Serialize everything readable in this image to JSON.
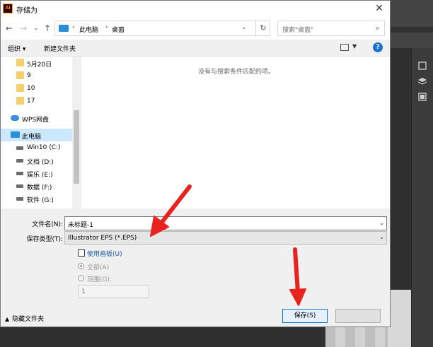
{
  "window": {
    "app_icon_text": "Ai",
    "title": "存储为"
  },
  "navigation": {
    "back_glyph": "←",
    "forward_glyph": "→",
    "history_glyph": "⌄",
    "up_glyph": "↑",
    "breadcrumb": [
      "此电脑",
      "桌面"
    ],
    "search_placeholder": "搜索\"桌面\""
  },
  "toolbar": {
    "organize_label": "组织 ▾",
    "new_folder_label": "新建文件夹",
    "help_glyph": "?"
  },
  "sidebar": {
    "items": [
      {
        "label": "5月20日",
        "icon": "folder-icon"
      },
      {
        "label": "9",
        "icon": "folder-icon"
      },
      {
        "label": "10",
        "icon": "folder-icon"
      },
      {
        "label": "17",
        "icon": "folder-icon"
      },
      {
        "label": "WPS网盘",
        "icon": "cloud-icon"
      },
      {
        "label": "此电脑",
        "icon": "computer-icon",
        "selected": true
      },
      {
        "label": "Win10 (C:)",
        "icon": "drive-icon"
      },
      {
        "label": "文档 (D:)",
        "icon": "drive-icon"
      },
      {
        "label": "娱乐 (E:)",
        "icon": "drive-icon"
      },
      {
        "label": "数据 (F:)",
        "icon": "drive-icon"
      },
      {
        "label": "软件 (G:)",
        "icon": "drive-icon"
      }
    ]
  },
  "content": {
    "empty_message": "没有与搜索条件匹配的项。"
  },
  "form": {
    "filename_label": "文件名(N):",
    "filename_value": "未标题-1",
    "filetype_label": "保存类型(T):",
    "filetype_value": "Illustrator EPS (*.EPS)",
    "use_artboards_label": "使用画板(U)",
    "all_label": "全部(A)",
    "range_label": "范围(G):",
    "range_value": "1"
  },
  "footer": {
    "hide_folders_label": "隐藏文件夹",
    "save_label": "保存(S)"
  },
  "colors": {
    "accent": "#0078d7",
    "annotation": "#e8231f",
    "selection": "#cce8ff"
  }
}
